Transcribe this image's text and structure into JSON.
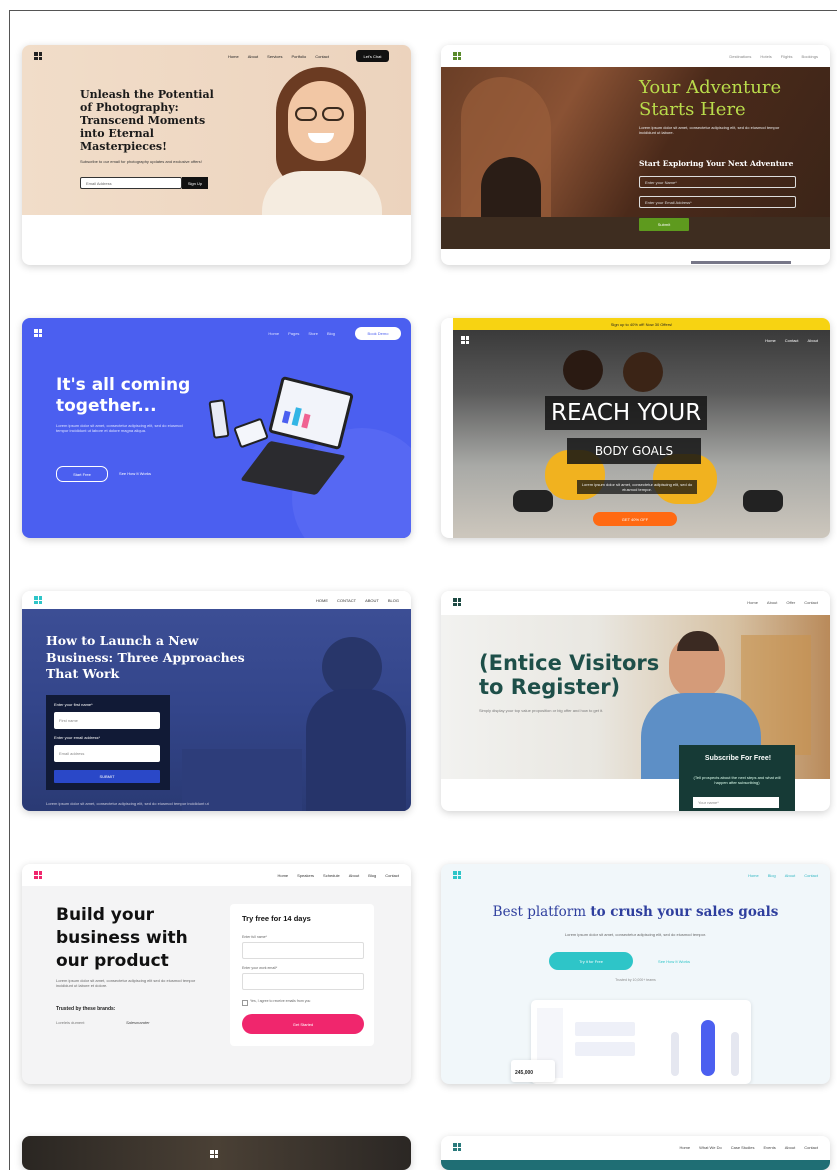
{
  "templates": [
    {
      "nav": [
        "Home",
        "About",
        "Services",
        "Portfolio",
        "Contact"
      ],
      "cta": "Let's Chat",
      "headline": "Unleash the Potential of Photography: Transcend Moments into Eternal Masterpieces!",
      "body": "Subscribe to our email for photography updates and exclusive offers!",
      "input": "Email Address",
      "button": "Sign Up"
    },
    {
      "nav": [
        "Destinations",
        "Hotels",
        "Flights",
        "Bookings"
      ],
      "headline": "Your Adventure Starts Here",
      "body": "Lorem ipsum dolor sit amet, consectetur adipiscing elit, sed do eiusmod tempor incididunt ut labore.",
      "subhead": "Start Exploring Your Next Adventure",
      "input1": "Enter your Name*",
      "input2": "Enter your Email Address*",
      "button": "Submit"
    },
    {
      "nav": [
        "Home",
        "Pages",
        "Store",
        "Blog"
      ],
      "cta": "Book Demo",
      "headline": "It's all coming together...",
      "body": "Lorem ipsum dolor sit amet, consectetur adipiscing elit, sed do eiusmod tempor incididunt ut labore et dolore magna aliqua.",
      "button1": "Start Free",
      "button2": "See How It Works"
    },
    {
      "banner": "Sign up to 40% off! Now 30 Offers!",
      "nav": [
        "Home",
        "Contact",
        "About"
      ],
      "headline": "REACH YOUR",
      "subhead": "BODY GOALS",
      "body": "Lorem ipsum dolor sit amet, consectetur adipiscing elit, sed do eiusmod tempor.",
      "button": "GET 40% OFF"
    },
    {
      "nav": [
        "HOME",
        "CONTACT",
        "ABOUT",
        "BLOG"
      ],
      "headline": "How to Launch a New Business: Three Approaches That Work",
      "label1": "Enter your first name*",
      "input1": "First name",
      "label2": "Enter your email address*",
      "input2": "Email address",
      "button": "SUBMIT",
      "footer": "Lorem ipsum dolor sit amet, consectetur adipiscing elit, sed do eiusmod tempor incididunt ut"
    },
    {
      "nav": [
        "Home",
        "About",
        "Offer",
        "Contact"
      ],
      "headline": "(Entice Visitors to Register)",
      "body": "Simply display your top value proposition or big offer and how to get it.",
      "box_title": "Subscribe For Free!",
      "box_body": "(Tell prospects about the next steps and what will happen after subscribing)",
      "input": "Your name*"
    },
    {
      "nav": [
        "Home",
        "Speakers",
        "Schedule",
        "About",
        "Blog",
        "Contact"
      ],
      "headline": "Build your business with our product",
      "body": "Lorem ipsum dolor sit amet, consectetur adipiscing elit sed do eiusmod tempor incididunt ut labore et dolore.",
      "trusted": "Trusted by these brands:",
      "brand1": "Loreleis dument",
      "brand2": "Salesmander",
      "form_title": "Try free for 14 days",
      "label1": "Enter full name*",
      "label2": "Enter your work email*",
      "check": "Yes, I agree to receive emails from you",
      "button": "Get Started"
    },
    {
      "nav": [
        "Home",
        "Blog",
        "About",
        "Contact"
      ],
      "headline_a": "Best platform",
      "headline_b": "to crush your sales goals",
      "body": "Lorem ipsum dolor sit amet, consectetur adipiscing elit, sed do eiusmod tempor.",
      "button1": "Try it for Free",
      "button2": "See How It Works",
      "note": "Trusted by 10,000+ teams",
      "stat": "245,000"
    },
    {
      "nav": []
    },
    {
      "nav": [
        "Home",
        "What We Do",
        "Case Studies",
        "Events",
        "About",
        "Contact"
      ]
    }
  ],
  "colors": {
    "blue": "#4b5ff0",
    "pink": "#f0266d",
    "teal": "#2ec5c8",
    "green": "#6a8f2a"
  }
}
